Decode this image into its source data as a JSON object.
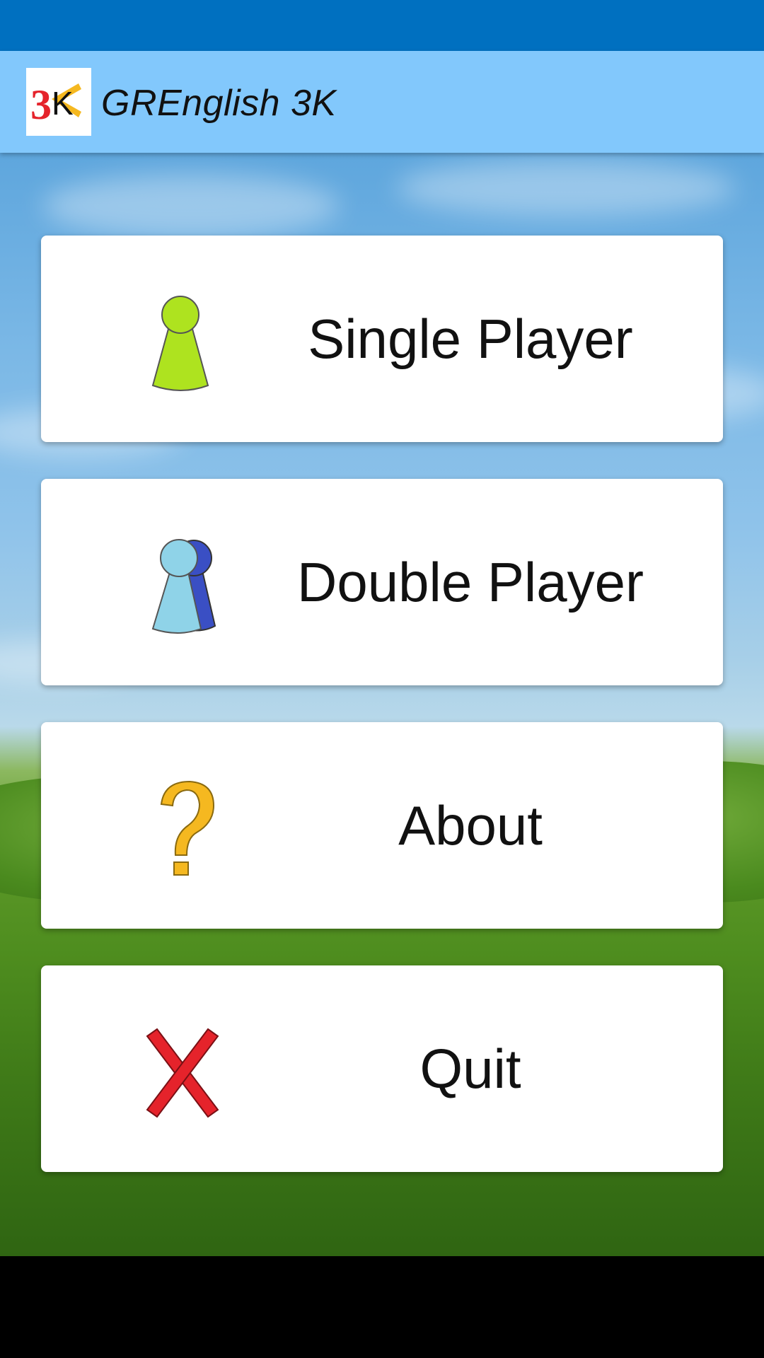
{
  "app": {
    "title": "GREnglish 3K",
    "logo_text_a": "3",
    "logo_text_b": "K"
  },
  "menu": {
    "items": [
      {
        "label": "Single Player",
        "icon": "single-player-pawn-icon"
      },
      {
        "label": "Double Player",
        "icon": "double-player-pawns-icon"
      },
      {
        "label": "About",
        "icon": "question-mark-icon"
      },
      {
        "label": "Quit",
        "icon": "close-x-icon"
      }
    ]
  },
  "colors": {
    "status_bar": "#0070c0",
    "app_bar": "#82c8fc",
    "pawn_green": "#aee31f",
    "pawn_light_blue": "#8fd3e8",
    "pawn_dark_blue": "#3a4fc4",
    "question_yellow": "#f5b820",
    "quit_red": "#e5232b"
  }
}
